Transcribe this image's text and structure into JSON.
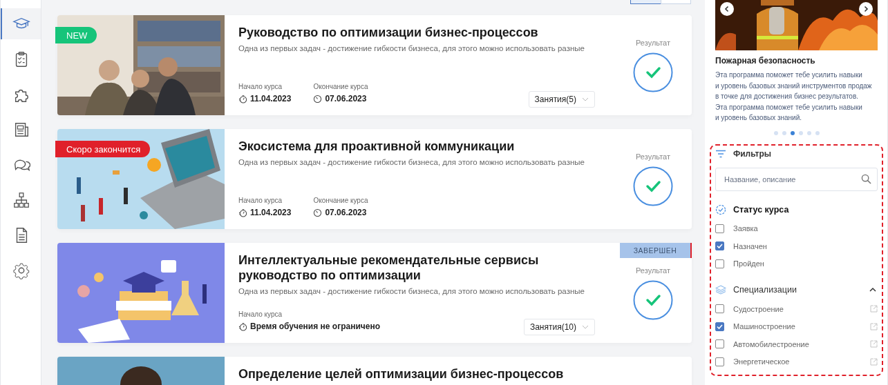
{
  "sidebar": {
    "items": [
      {
        "kind": "cap",
        "selected": true
      },
      {
        "kind": "checklist",
        "selected": false
      },
      {
        "kind": "puzzle",
        "selected": false
      },
      {
        "kind": "news",
        "selected": false
      },
      {
        "kind": "chat",
        "selected": false
      },
      {
        "kind": "hierarchy",
        "selected": false
      },
      {
        "kind": "document",
        "selected": false
      },
      {
        "kind": "gear",
        "selected": false
      }
    ]
  },
  "courses": [
    {
      "badge": {
        "text": "NEW",
        "kind": "new"
      },
      "title": "Руководство по оптимизации бизнес-процессов",
      "description": "Одна из первых задач - достижение гибкости бизнеса, для этого можно использовать разные",
      "start_label": "Начало курса",
      "start_date": "11.04.2023",
      "end_label": "Окончание курса",
      "end_date": "07.06.2023",
      "lessons": "Занятия(5)",
      "result_label": "Результат",
      "result_done": true
    },
    {
      "badge": {
        "text": "Скоро закончится",
        "kind": "ending"
      },
      "title": "Экосистема для проактивной коммуникации",
      "description": "Одна из первых задач - достижение гибкости бизнеса, для этого можно использовать разные",
      "start_label": "Начало курса",
      "start_date": "11.04.2023",
      "end_label": "Окончание курса",
      "end_date": "07.06.2023",
      "result_label": "Результат",
      "result_done": true
    },
    {
      "status": "ЗАВЕРШЕН",
      "title": "Интеллектуальные рекомендательные сервисы руководство по оптимизации",
      "description": "Одна из первых задач - достижение гибкости бизнеса, для этого можно использовать разные",
      "start_label": "Начало курса",
      "start_date": "Время обучения не ограничено",
      "lessons": "Занятия(10)",
      "result_label": "Результат",
      "result_done": true
    },
    {
      "title": "Определение целей оптимизации бизнес-процессов"
    }
  ],
  "promo": {
    "title": "Пожарная безопасность",
    "text": "Эта программа поможет тебе усилить навыки\nи уровень базовых знаний инструментов продаж\nв точке для достижения бизнес результатов.\nЭта программа поможет тебе усилить навыки\nи уровень базовых знаний.",
    "dots": [
      {
        "selected": false
      },
      {
        "selected": false
      },
      {
        "selected": true
      },
      {
        "selected": false
      },
      {
        "selected": false
      },
      {
        "selected": false
      }
    ]
  },
  "filters": {
    "title": "Фильтры",
    "search": {
      "placeholder": "Название, описание"
    },
    "groups": [
      {
        "kind": "status",
        "title": "Статус курса",
        "options": [
          {
            "label": "Заявка",
            "checked": false
          },
          {
            "label": "Назначен",
            "checked": true
          },
          {
            "label": "Пройден",
            "checked": false
          }
        ]
      },
      {
        "kind": "specialization",
        "title": "Специализации",
        "expanded": true,
        "options": [
          {
            "label": "Судостроение",
            "checked": false,
            "linked": true
          },
          {
            "label": "Машиностроение",
            "checked": true,
            "linked": true
          },
          {
            "label": "Автомобилестроение",
            "checked": false,
            "linked": true
          },
          {
            "label": "Энергетическое",
            "checked": false,
            "linked": true
          }
        ]
      }
    ]
  }
}
